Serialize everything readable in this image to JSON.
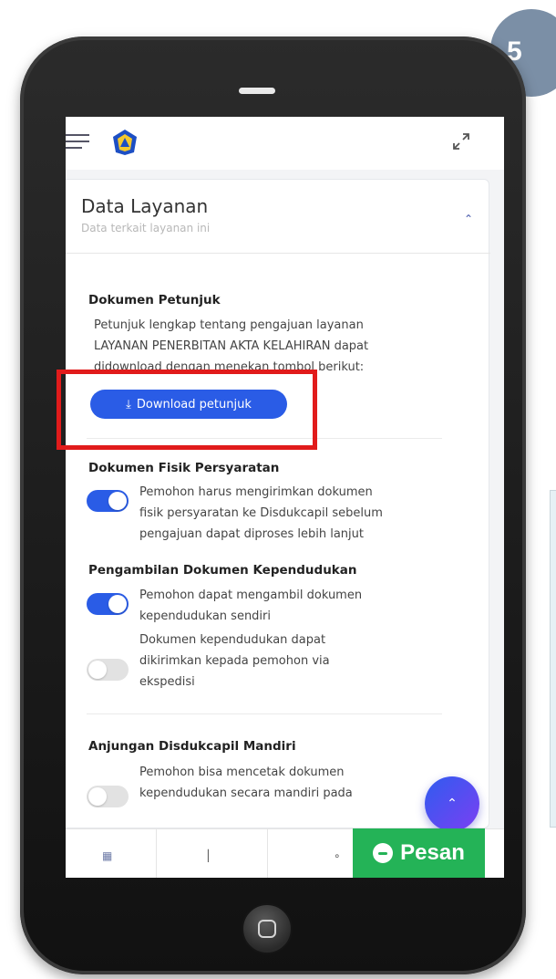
{
  "step": "5",
  "section": {
    "title": "Data Layanan",
    "subtitle": "Data terkait layanan ini"
  },
  "dokumen_petunjuk": {
    "heading": "Dokumen Petunjuk",
    "text_lines": [
      "Petunjuk lengkap tentang pengajuan layanan",
      "LAYANAN PENERBITAN AKTA KELAHIRAN dapat",
      "didownload dengan menekan tombol berikut:"
    ],
    "button_label": "Download petunjuk"
  },
  "dokumen_fisik": {
    "heading": "Dokumen Fisik Persyaratan",
    "toggle_on": true,
    "text_lines": [
      "Pemohon harus mengirimkan dokumen",
      "fisik persyaratan ke Disdukcapil sebelum",
      "pengajuan dapat diproses lebih lanjut"
    ]
  },
  "pengambilan": {
    "heading": "Pengambilan Dokumen Kependudukan",
    "option1": {
      "toggle_on": true,
      "text_lines": [
        "Pemohon dapat mengambil dokumen",
        "kependudukan sendiri"
      ]
    },
    "option2": {
      "toggle_on": false,
      "text_lines": [
        "Dokumen kependudukan dapat",
        "dikirimkan kepada pemohon via",
        "ekspedisi"
      ]
    }
  },
  "anjungan": {
    "heading": "Anjungan Disdukcapil Mandiri",
    "toggle_on": false,
    "text_lines": [
      "Pemohon bisa mencetak dokumen",
      "kependudukan secara mandiri pada"
    ]
  },
  "bottom_nav": {
    "pesan_label": "Pesan"
  },
  "icons": {
    "menu": "hamburger-menu-icon",
    "logo": "app-logo",
    "expand": "expand-icon",
    "collapse": "chevron-up-icon",
    "download": "download-icon",
    "scroll_top": "chevron-up-icon",
    "chat": "chat-icon"
  },
  "colors": {
    "primary": "#2a5ce6",
    "highlight": "#e11b1b",
    "pesan_bg": "#24b357",
    "badge": "#7b8fa6"
  }
}
